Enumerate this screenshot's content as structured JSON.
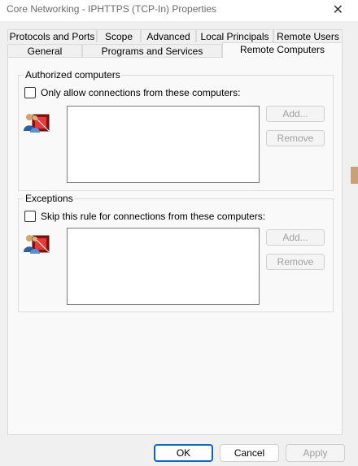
{
  "window": {
    "title": "Core Networking - IPHTTPS (TCP-In) Properties",
    "close_glyph": "✕"
  },
  "tabs": {
    "row1": [
      "Protocols and Ports",
      "Scope",
      "Advanced",
      "Local Principals",
      "Remote Users"
    ],
    "row2": [
      "General",
      "Programs and Services",
      "Remote Computers"
    ],
    "active": "Remote Computers"
  },
  "authorized": {
    "group_label": "Authorized computers",
    "checkbox_label": "Only allow connections from these computers:",
    "checked": false,
    "add_label": "Add...",
    "remove_label": "Remove"
  },
  "exceptions": {
    "group_label": "Exceptions",
    "checkbox_label": "Skip this rule for connections from these computers:",
    "checked": false,
    "add_label": "Add...",
    "remove_label": "Remove"
  },
  "footer": {
    "ok_label": "OK",
    "cancel_label": "Cancel",
    "apply_label": "Apply"
  },
  "colors": {
    "primary_border": "#0a63c9",
    "disabled_text": "#a0a0a0"
  },
  "icons": [
    "users-network-icon"
  ]
}
